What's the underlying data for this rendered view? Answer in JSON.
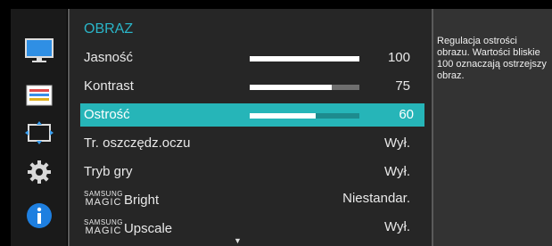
{
  "menu": {
    "title": "OBRAZ",
    "items": [
      {
        "label": "Jasność",
        "value": "100",
        "level": 1.0
      },
      {
        "label": "Kontrast",
        "value": "75",
        "level": 0.75
      },
      {
        "label": "Ostrość",
        "value": "60",
        "level": 0.6,
        "selected": true
      },
      {
        "label": "Tr. oszczędz.oczu",
        "value": "Wył."
      },
      {
        "label": "Tryb gry",
        "value": "Wył."
      },
      {
        "brand_top": "SAMSUNG",
        "brand_bottom": "MAGIC",
        "label": "Bright",
        "value": "Niestandar."
      },
      {
        "brand_top": "SAMSUNG",
        "brand_bottom": "MAGIC",
        "label": "Upscale",
        "value": "Wył."
      }
    ],
    "scroll_glyph": "▼"
  },
  "help_text": "Regulacja ostrości obrazu. Wartości bliskie 100 oznaczają ostrzejszy obraz.",
  "icons": [
    "monitor-icon",
    "picture-settings-icon",
    "position-size-icon",
    "gear-icon",
    "info-icon"
  ],
  "colors": {
    "accent": "#26b5b8",
    "title": "#2ab4c7",
    "info_blue": "#1e7fe0"
  }
}
